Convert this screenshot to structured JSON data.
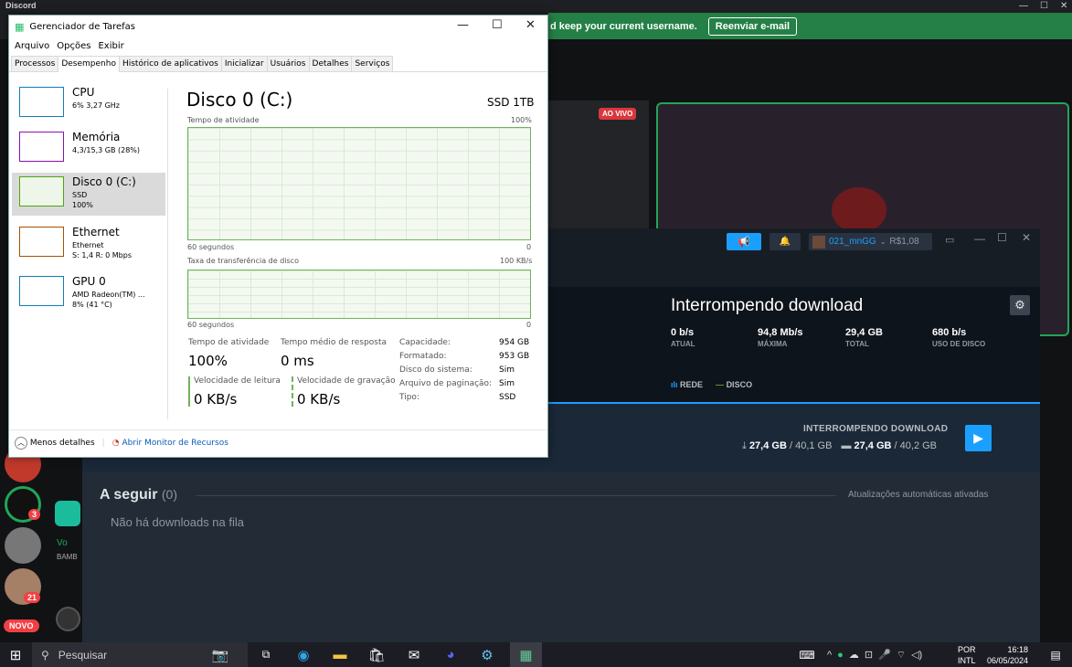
{
  "discord": {
    "app_name": "Discord",
    "banner_text": "d keep your current username.",
    "banner_button": "Reenviar e-mail",
    "live_badge": "AO VIVO",
    "novo_badge": "NOVO",
    "server_badges": [
      "3",
      "21"
    ],
    "partial_labels": [
      "Vo",
      "BAMB"
    ]
  },
  "task_manager": {
    "window_title": "Gerenciador de Tarefas",
    "menu": [
      "Arquivo",
      "Opções",
      "Exibir"
    ],
    "tabs": [
      "Processos",
      "Desempenho",
      "Histórico de aplicativos",
      "Inicializar",
      "Usuários",
      "Detalhes",
      "Serviços"
    ],
    "active_tab": "Desempenho",
    "sidebar": [
      {
        "name": "CPU",
        "sub1": "6% 3,27 GHz",
        "sub2": "",
        "sub3": ""
      },
      {
        "name": "Memória",
        "sub1": "4,3/15,3 GB (28%)",
        "sub2": "",
        "sub3": ""
      },
      {
        "name": "Disco 0 (C:)",
        "sub1": "SSD",
        "sub2": "100%",
        "sub3": ""
      },
      {
        "name": "Ethernet",
        "sub1": "Ethernet",
        "sub2": "S: 1,4 R: 0 Mbps",
        "sub3": ""
      },
      {
        "name": "GPU 0",
        "sub1": "AMD Radeon(TM) ...",
        "sub2": "8% (41 °C)",
        "sub3": ""
      }
    ],
    "disk_title": "Disco 0 (C:)",
    "disk_model": "SSD 1TB",
    "graph1_label": "Tempo de atividade",
    "graph1_max": "100%",
    "graph1_time": "60 segundos",
    "graph1_min": "0",
    "graph2_label": "Taxa de transferência de disco",
    "graph2_max": "100 KB/s",
    "graph2_time": "60 segundos",
    "graph2_min": "0",
    "active_time_label": "Tempo de atividade",
    "active_time_value": "100%",
    "response_label": "Tempo médio de resposta",
    "response_value": "0 ms",
    "read_label": "Velocidade de leitura",
    "read_value": "0 KB/s",
    "write_label": "Velocidade de gravação",
    "write_value": "0 KB/s",
    "props": [
      {
        "k": "Capacidade:",
        "v": "954 GB"
      },
      {
        "k": "Formatado:",
        "v": "953 GB"
      },
      {
        "k": "Disco do sistema:",
        "v": "Sim"
      },
      {
        "k": "Arquivo de paginação:",
        "v": "Sim"
      },
      {
        "k": "Tipo:",
        "v": "SSD"
      }
    ],
    "fewer_details": "Menos detalhes",
    "resource_monitor": "Abrir Monitor de Recursos"
  },
  "steam": {
    "username": "021_mnGG",
    "balance": "R$1,08",
    "download_title": "Interrompendo download",
    "stats": [
      {
        "v": "0 b/s",
        "l": "ATUAL"
      },
      {
        "v": "94,8 Mb/s",
        "l": "MÁXIMA"
      },
      {
        "v": "29,4 GB",
        "l": "TOTAL"
      },
      {
        "v": "680 b/s",
        "l": "USO DE DISCO"
      }
    ],
    "legend_network": "REDE",
    "legend_disk": "DISCO",
    "status": "INTERROMPENDO DOWNLOAD",
    "download_done": "27,4 GB",
    "download_total": "/ 40,1 GB",
    "disk_done": "27,4 GB",
    "disk_total": "/ 40,2 GB",
    "queue_title": "A seguir",
    "queue_count": "(0)",
    "auto_updates": "Atualizações automáticas ativadas",
    "queue_empty": "Não há downloads na fila"
  },
  "taskbar": {
    "search_placeholder": "Pesquisar",
    "lang1": "POR",
    "lang2": "INTL",
    "time": "16:18",
    "date": "06/05/2024"
  },
  "colors": {
    "discord_green": "#248046",
    "steam_blue": "#1a9fff",
    "disk_graph": "#6eb35c",
    "cpu_graph": "#117dbb",
    "memory_graph": "#8b12ae",
    "ethernet_graph": "#a74f01"
  }
}
